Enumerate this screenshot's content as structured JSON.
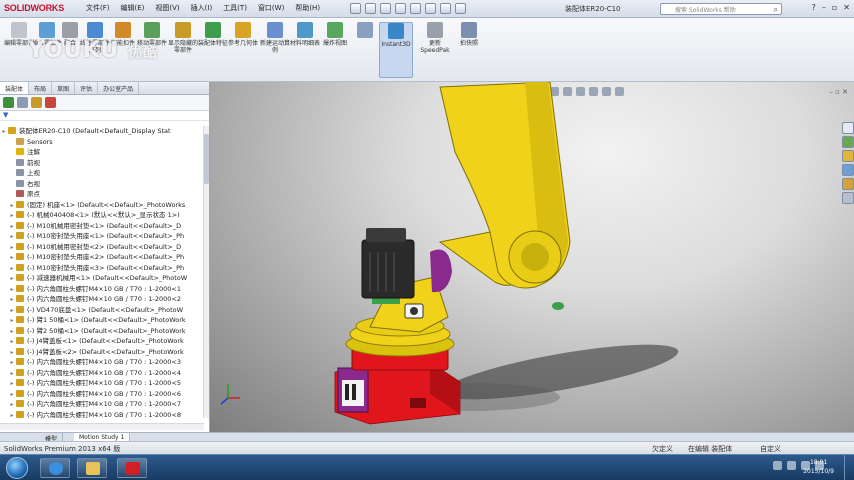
{
  "app": {
    "brand": "SOLIDWORKS",
    "document_title": "装配体ER20-C10",
    "search_placeholder": "搜索 SolidWorks 帮助",
    "menus": [
      "文件(F)",
      "编辑(E)",
      "视图(V)",
      "插入(I)",
      "工具(T)",
      "窗口(W)",
      "帮助(H)"
    ]
  },
  "watermark": {
    "text": "YOUKU",
    "suffix": "优酷"
  },
  "command_manager": {
    "buttons": [
      {
        "label": "编辑零部件",
        "icon": "edit-component-icon",
        "color": "#c0c4cc"
      },
      {
        "label": "插入零部件",
        "icon": "insert-components-icon",
        "color": "#5c9fd6"
      },
      {
        "label": "配合",
        "icon": "mate-icon",
        "color": "#9b9fa8"
      },
      {
        "label": "线性零部件阵列",
        "icon": "pattern-icon",
        "color": "#4a8cd1"
      },
      {
        "label": "智能扣件",
        "icon": "smart-fasteners-icon",
        "color": "#d08a2a"
      },
      {
        "label": "移动零部件",
        "icon": "move-component-icon",
        "color": "#5aa05a"
      },
      {
        "label": "显示隐藏的零部件",
        "icon": "show-hidden-icon",
        "color": "#c79c2a"
      },
      {
        "label": "装配体特征",
        "icon": "assembly-features-icon",
        "color": "#3f9d4d"
      },
      {
        "label": "参考几何体",
        "icon": "reference-geometry-icon",
        "color": "#d8a425"
      },
      {
        "label": "新建运动算例",
        "icon": "motion-study-icon",
        "color": "#6b8fcf"
      },
      {
        "label": "材料明细表",
        "icon": "bom-icon",
        "color": "#4f98c9"
      },
      {
        "label": "爆炸视图",
        "icon": "exploded-view-icon",
        "color": "#59a85f"
      },
      {
        "label": "Instant3D",
        "icon": "instant3d-icon",
        "color": "#3b86c7"
      },
      {
        "label": "更新 SpeedPak",
        "icon": "speedpak-icon",
        "color": "#9aa0aa"
      },
      {
        "label": "拍快照",
        "icon": "snapshot-icon",
        "color": "#7d8fb0"
      }
    ]
  },
  "panel": {
    "tabs": [
      "装配体",
      "布局",
      "草图",
      "评估",
      "办公室产品"
    ],
    "tree": [
      {
        "label": "装配体ER20-C10  (Default<Default_Display Stat",
        "root": true,
        "color": "#d6a21b"
      },
      {
        "label": "Sensors",
        "color": "#c9a44a"
      },
      {
        "label": "注解",
        "color": "#e2b400"
      },
      {
        "label": "前视",
        "color": "#8a94a8"
      },
      {
        "label": "上视",
        "color": "#8a94a8"
      },
      {
        "label": "右视",
        "color": "#8a94a8"
      },
      {
        "label": "原点",
        "color": "#b25a5a"
      },
      {
        "label": "(固定) 机座<1> (Default<<Default>_PhotoWorks",
        "color": "#d0a020"
      },
      {
        "label": "(-) 机械040408<1> (默认<<默认>_显示状态 1>)",
        "color": "#d0a020"
      },
      {
        "label": "(-) M10机械用密封垫<1> (Default<<Default>_D",
        "color": "#d0a020"
      },
      {
        "label": "(-) M10密封垫头用座<1> (Default<<Default>_Ph",
        "color": "#d0a020"
      },
      {
        "label": "(-) M10机械用密封垫<2> (Default<<Default>_D",
        "color": "#d0a020"
      },
      {
        "label": "(-) M10密封垫头用座<2> (Default<<Default>_Ph",
        "color": "#d0a020"
      },
      {
        "label": "(-) M10密封垫头用座<3> (Default<<Default>_Ph",
        "color": "#d0a020"
      },
      {
        "label": "(-) 减速器机械用<1> (Default<<Default>_PhotoW",
        "color": "#d0a020"
      },
      {
        "label": "(-) 内六角圆柱头螺钉M4×10 GB / T70 : 1-2000<1",
        "color": "#d0a020"
      },
      {
        "label": "(-) 内六角圆柱头螺钉M4×10 GB / T70 : 1-2000<2",
        "color": "#d0a020"
      },
      {
        "label": "(-) VD470底盘<1> (Default<<Default>_PhotoW",
        "color": "#d0a020"
      },
      {
        "label": "(-) 臂1 50桶<1> (Default<<Default>_PhotoWork",
        "color": "#d0a020"
      },
      {
        "label": "(-) 臂2 50桶<1> (Default<<Default>_PhotoWork",
        "color": "#d0a020"
      },
      {
        "label": "(-) J4臂盖板<1> (Default<<Default>_PhotoWork",
        "color": "#d0a020"
      },
      {
        "label": "(-) J4臂盖板<2> (Default<<Default>_PhotoWork",
        "color": "#d0a020"
      },
      {
        "label": "(-) 内六角圆柱头螺钉M4×10 GB / T70 : 1-2000<3",
        "color": "#d0a020"
      },
      {
        "label": "(-) 内六角圆柱头螺钉M4×10 GB / T70 : 1-2000<4",
        "color": "#d0a020"
      },
      {
        "label": "(-) 内六角圆柱头螺钉M4×10 GB / T70 : 1-2000<5",
        "color": "#d0a020"
      },
      {
        "label": "(-) 内六角圆柱头螺钉M4×10 GB / T70 : 1-2000<6",
        "color": "#d0a020"
      },
      {
        "label": "(-) 内六角圆柱头螺钉M4×10 GB / T70 : 1-2000<7",
        "color": "#d0a020"
      },
      {
        "label": "(-) 内六角圆柱头螺钉M4×10 GB / T70 : 1-2000<8",
        "color": "#d0a020"
      }
    ]
  },
  "model_tabs": [
    "模型",
    "Motion Study 1"
  ],
  "status": {
    "left": "SolidWorks Premium 2013 x64 版",
    "items": [
      "欠定义",
      "在编辑 装配体",
      "自定义"
    ]
  },
  "taskbar": {
    "clock_time": "18:01",
    "clock_date": "2015/10/9"
  },
  "colors": {
    "robot_yellow": "#f0d21a",
    "robot_red": "#e0161c",
    "base_purple": "#8b2a8e",
    "motor_black": "#2a2a2a"
  }
}
